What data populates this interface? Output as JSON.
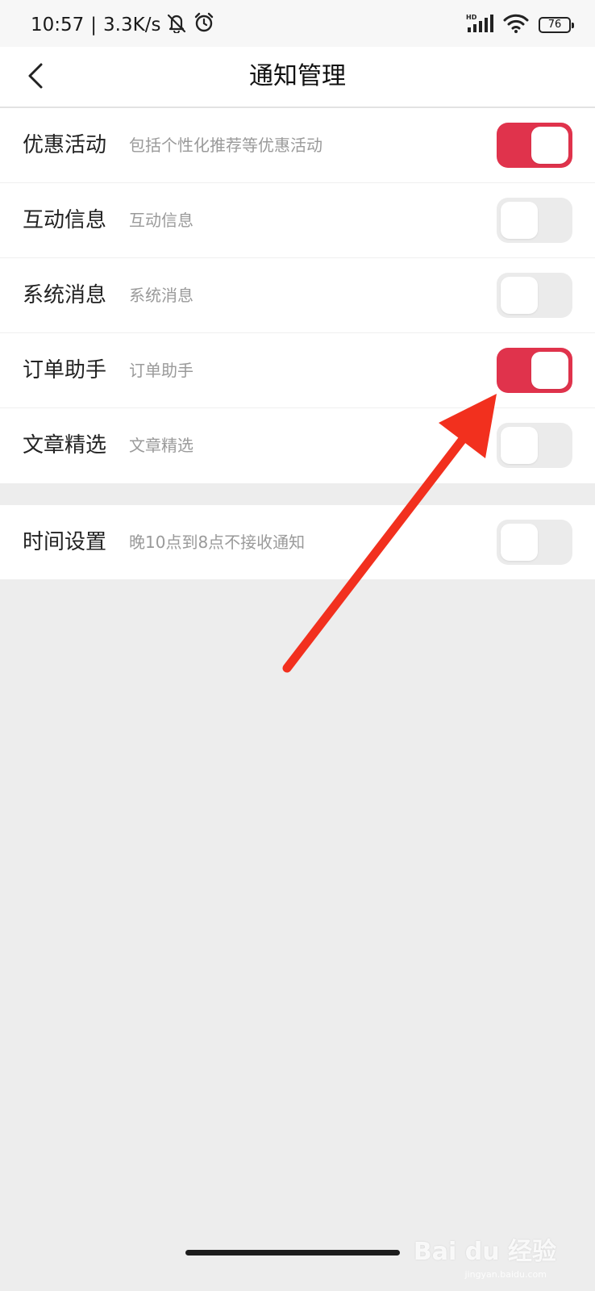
{
  "status_bar": {
    "time": "10:57",
    "separator": "|",
    "speed": "3.3K/s",
    "network_label": "HD",
    "battery": "76",
    "icons": [
      "bell-off-icon",
      "alarm-icon",
      "signal-icon",
      "wifi-icon",
      "battery-icon"
    ]
  },
  "header": {
    "title": "通知管理",
    "back_icon": "chevron-left-icon"
  },
  "settings": [
    {
      "title": "优惠活动",
      "desc": "包括个性化推荐等优惠活动",
      "enabled": true
    },
    {
      "title": "互动信息",
      "desc": "互动信息",
      "enabled": false
    },
    {
      "title": "系统消息",
      "desc": "系统消息",
      "enabled": false
    },
    {
      "title": "订单助手",
      "desc": "订单助手",
      "enabled": true
    },
    {
      "title": "文章精选",
      "desc": "文章精选",
      "enabled": false
    }
  ],
  "time_setting": {
    "title": "时间设置",
    "desc": "晚10点到8点不接收通知",
    "enabled": false
  },
  "annotation": {
    "arrow_color": "#f2301e",
    "points_to": "订单助手"
  },
  "watermark": {
    "text": "Bai du 经验",
    "sub": "jingyan.baidu.com"
  },
  "colors": {
    "toggle_on": "#e0334c",
    "toggle_off": "#ebebeb",
    "page_bg": "#ededed"
  }
}
